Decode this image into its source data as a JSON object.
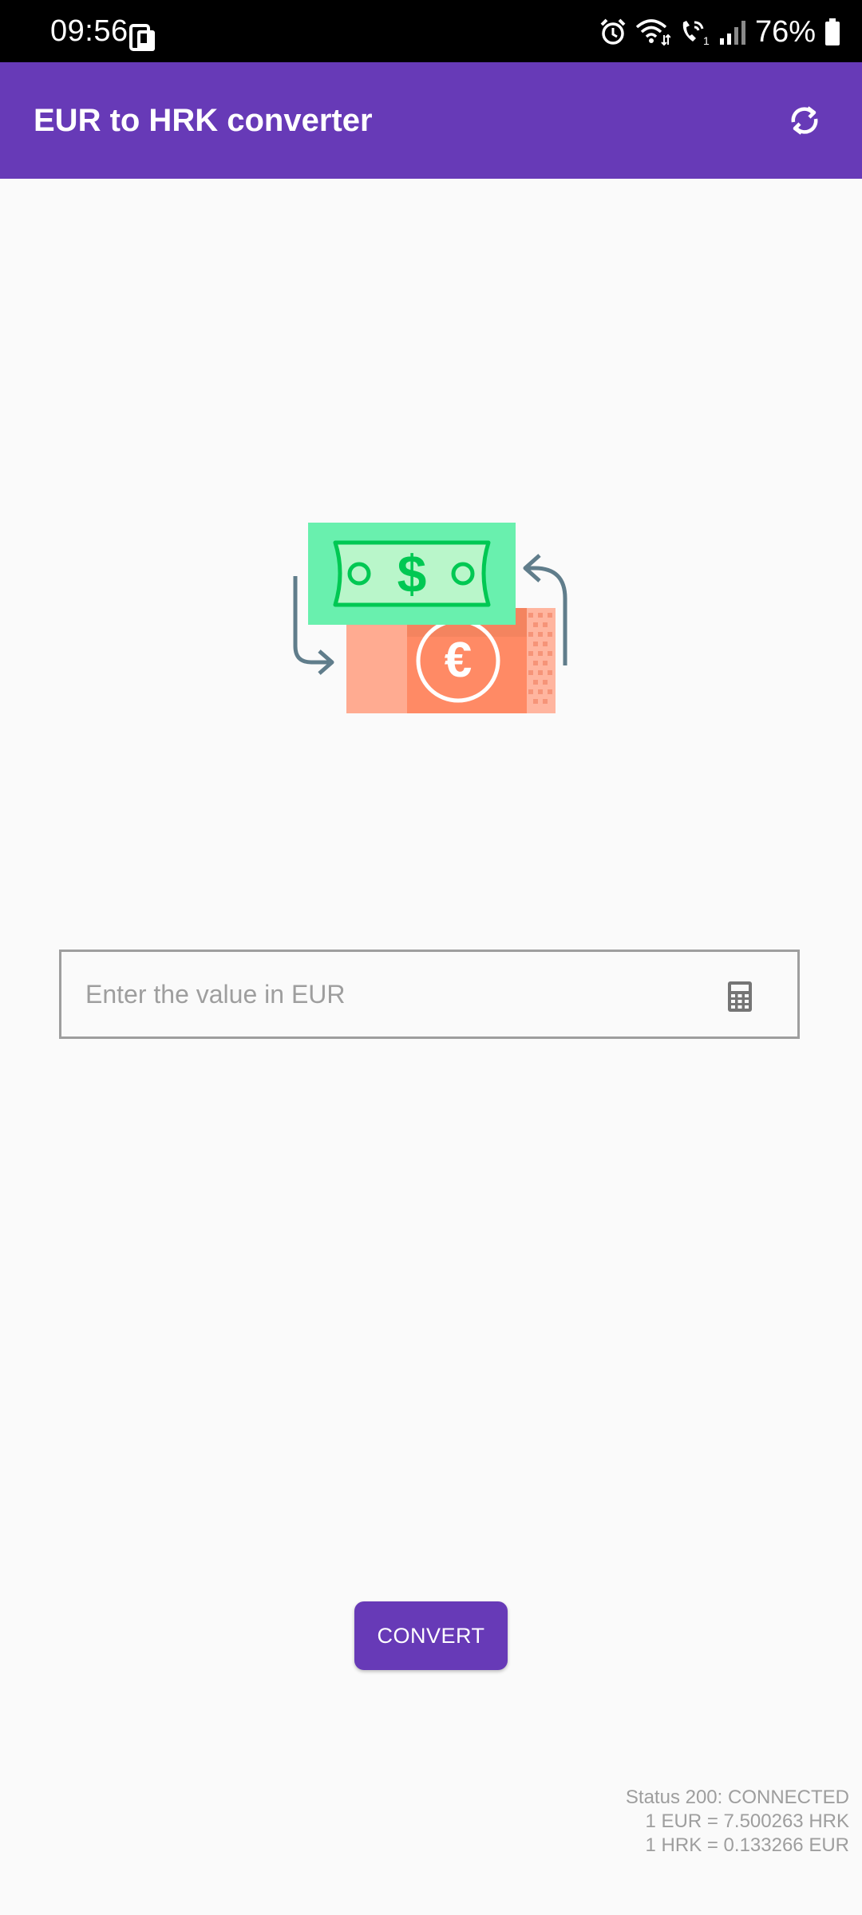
{
  "status_bar": {
    "time": "09:56",
    "battery": "76%",
    "icons": [
      "cast-icon",
      "alarm-icon",
      "wifi-icon",
      "wifi-calling-icon",
      "signal-icon",
      "battery-icon"
    ]
  },
  "app_bar": {
    "title": "EUR to HRK converter",
    "action_icon": "swap-icon",
    "color": "#673ab7"
  },
  "illustration": {
    "icon": "currency-exchange-illustration",
    "colors": {
      "dollar_note": "#69f0ae",
      "dollar_symbol": "#00c853",
      "euro_note": "#ff8a65",
      "arrows": "#607d8b"
    }
  },
  "input": {
    "placeholder": "Enter the value in EUR",
    "value": "",
    "icon": "calculator-icon"
  },
  "convert_button": {
    "label": "CONVERT"
  },
  "status_info": {
    "status": "Status 200: CONNECTED",
    "rate_eur_hrk": "1 EUR = 7.500263 HRK",
    "rate_hrk_eur": "1 HRK = 0.133266 EUR"
  }
}
